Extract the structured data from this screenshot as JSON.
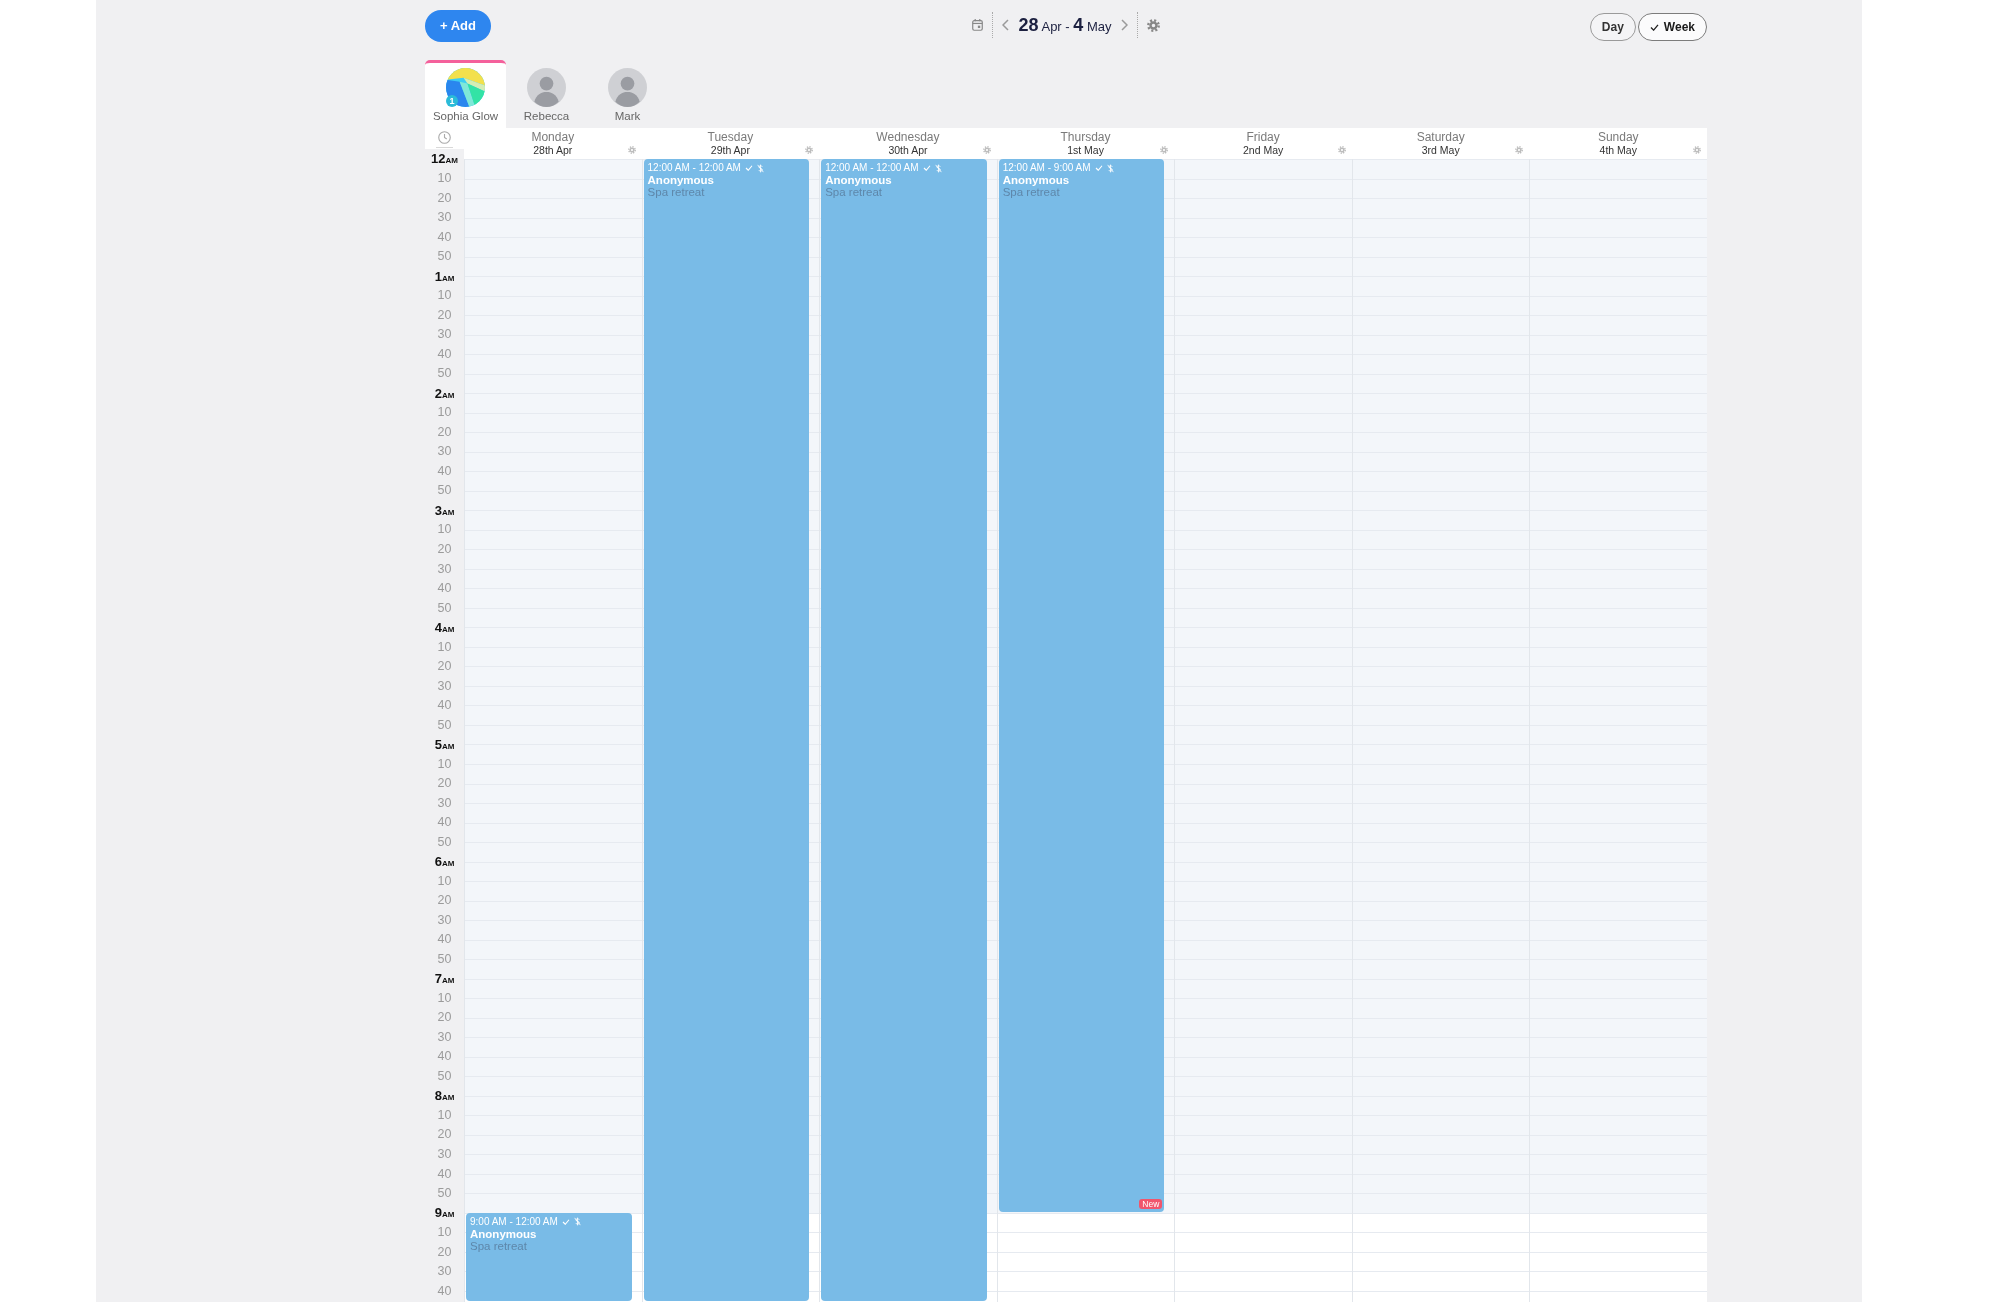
{
  "toolbar": {
    "add_button": "+ Add",
    "date_range": "**28** Apr - **4** May",
    "view_buttons": [
      {
        "label": "Day",
        "selected": false
      },
      {
        "label": "Week",
        "selected": true
      }
    ]
  },
  "staff": [
    {
      "name": "Sophia Glow",
      "kind": "logo",
      "badge": "1",
      "selected": true
    },
    {
      "name": "Rebecca",
      "kind": "photo",
      "selected": false
    },
    {
      "name": "Mark",
      "kind": "photo",
      "selected": false
    }
  ],
  "calendar": {
    "time_rows": [
      {
        "kind": "hour",
        "label": "12",
        "period": "AM",
        "closed": true
      },
      {
        "kind": "minute",
        "label": "10",
        "closed": true
      },
      {
        "kind": "minute",
        "label": "20",
        "closed": true
      },
      {
        "kind": "minute",
        "label": "30",
        "closed": true
      },
      {
        "kind": "minute",
        "label": "40",
        "closed": true
      },
      {
        "kind": "minute",
        "label": "50",
        "closed": true
      },
      {
        "kind": "hour",
        "label": "1",
        "period": "AM",
        "closed": true
      },
      {
        "kind": "minute",
        "label": "10",
        "closed": true
      },
      {
        "kind": "minute",
        "label": "20",
        "closed": true
      },
      {
        "kind": "minute",
        "label": "30",
        "closed": true
      },
      {
        "kind": "minute",
        "label": "40",
        "closed": true
      },
      {
        "kind": "minute",
        "label": "50",
        "closed": true
      },
      {
        "kind": "hour",
        "label": "2",
        "period": "AM",
        "closed": true
      },
      {
        "kind": "minute",
        "label": "10",
        "closed": true
      },
      {
        "kind": "minute",
        "label": "20",
        "closed": true
      },
      {
        "kind": "minute",
        "label": "30",
        "closed": true
      },
      {
        "kind": "minute",
        "label": "40",
        "closed": true
      },
      {
        "kind": "minute",
        "label": "50",
        "closed": true
      },
      {
        "kind": "hour",
        "label": "3",
        "period": "AM",
        "closed": true
      },
      {
        "kind": "minute",
        "label": "10",
        "closed": true
      },
      {
        "kind": "minute",
        "label": "20",
        "closed": true
      },
      {
        "kind": "minute",
        "label": "30",
        "closed": true
      },
      {
        "kind": "minute",
        "label": "40",
        "closed": true
      },
      {
        "kind": "minute",
        "label": "50",
        "closed": true
      },
      {
        "kind": "hour",
        "label": "4",
        "period": "AM",
        "closed": true
      },
      {
        "kind": "minute",
        "label": "10",
        "closed": true
      },
      {
        "kind": "minute",
        "label": "20",
        "closed": true
      },
      {
        "kind": "minute",
        "label": "30",
        "closed": true
      },
      {
        "kind": "minute",
        "label": "40",
        "closed": true
      },
      {
        "kind": "minute",
        "label": "50",
        "closed": true
      },
      {
        "kind": "hour",
        "label": "5",
        "period": "AM",
        "closed": true
      },
      {
        "kind": "minute",
        "label": "10",
        "closed": true
      },
      {
        "kind": "minute",
        "label": "20",
        "closed": true
      },
      {
        "kind": "minute",
        "label": "30",
        "closed": true
      },
      {
        "kind": "minute",
        "label": "40",
        "closed": true
      },
      {
        "kind": "minute",
        "label": "50",
        "closed": true
      },
      {
        "kind": "hour",
        "label": "6",
        "period": "AM",
        "closed": true
      },
      {
        "kind": "minute",
        "label": "10",
        "closed": true
      },
      {
        "kind": "minute",
        "label": "20",
        "closed": true
      },
      {
        "kind": "minute",
        "label": "30",
        "closed": true
      },
      {
        "kind": "minute",
        "label": "40",
        "closed": true
      },
      {
        "kind": "minute",
        "label": "50",
        "closed": true
      },
      {
        "kind": "hour",
        "label": "7",
        "period": "AM",
        "closed": true
      },
      {
        "kind": "minute",
        "label": "10",
        "closed": true
      },
      {
        "kind": "minute",
        "label": "20",
        "closed": true
      },
      {
        "kind": "minute",
        "label": "30",
        "closed": true
      },
      {
        "kind": "minute",
        "label": "40",
        "closed": true
      },
      {
        "kind": "minute",
        "label": "50",
        "closed": true
      },
      {
        "kind": "hour",
        "label": "8",
        "period": "AM",
        "closed": true
      },
      {
        "kind": "minute",
        "label": "10",
        "closed": true
      },
      {
        "kind": "minute",
        "label": "20",
        "closed": true
      },
      {
        "kind": "minute",
        "label": "30",
        "closed": true
      },
      {
        "kind": "minute",
        "label": "40",
        "closed": true
      },
      {
        "kind": "minute",
        "label": "50",
        "closed": true
      },
      {
        "kind": "hour",
        "label": "9",
        "period": "AM",
        "closed": false
      },
      {
        "kind": "minute",
        "label": "10",
        "closed": false
      },
      {
        "kind": "minute",
        "label": "20",
        "closed": false
      },
      {
        "kind": "minute",
        "label": "30",
        "closed": false
      },
      {
        "kind": "minute",
        "label": "40",
        "closed": false
      }
    ],
    "days": [
      {
        "weekday": "Monday",
        "date": "28th Apr",
        "events": [
          {
            "time": "9:00 AM - 12:00 AM",
            "confirmed": true,
            "paid": false,
            "client": "Anonymous",
            "service": "Spa retreat"
          }
        ]
      },
      {
        "weekday": "Tuesday",
        "date": "29th Apr",
        "events": [
          {
            "time": "12:00 AM - 12:00 AM",
            "confirmed": true,
            "paid": false,
            "client": "Anonymous",
            "service": "Spa retreat"
          }
        ]
      },
      {
        "weekday": "Wednesday",
        "date": "30th Apr",
        "events": [
          {
            "time": "12:00 AM - 12:00 AM",
            "confirmed": true,
            "paid": false,
            "client": "Anonymous",
            "service": "Spa retreat"
          }
        ]
      },
      {
        "weekday": "Thursday",
        "date": "1st May",
        "events": [
          {
            "time": "12:00 AM - 9:00 AM",
            "confirmed": true,
            "paid": false,
            "client": "Anonymous",
            "service": "Spa retreat",
            "badge": "New"
          }
        ]
      },
      {
        "weekday": "Friday",
        "date": "2nd May"
      },
      {
        "weekday": "Saturday",
        "date": "3rd May"
      },
      {
        "weekday": "Sunday",
        "date": "4th May"
      }
    ]
  }
}
